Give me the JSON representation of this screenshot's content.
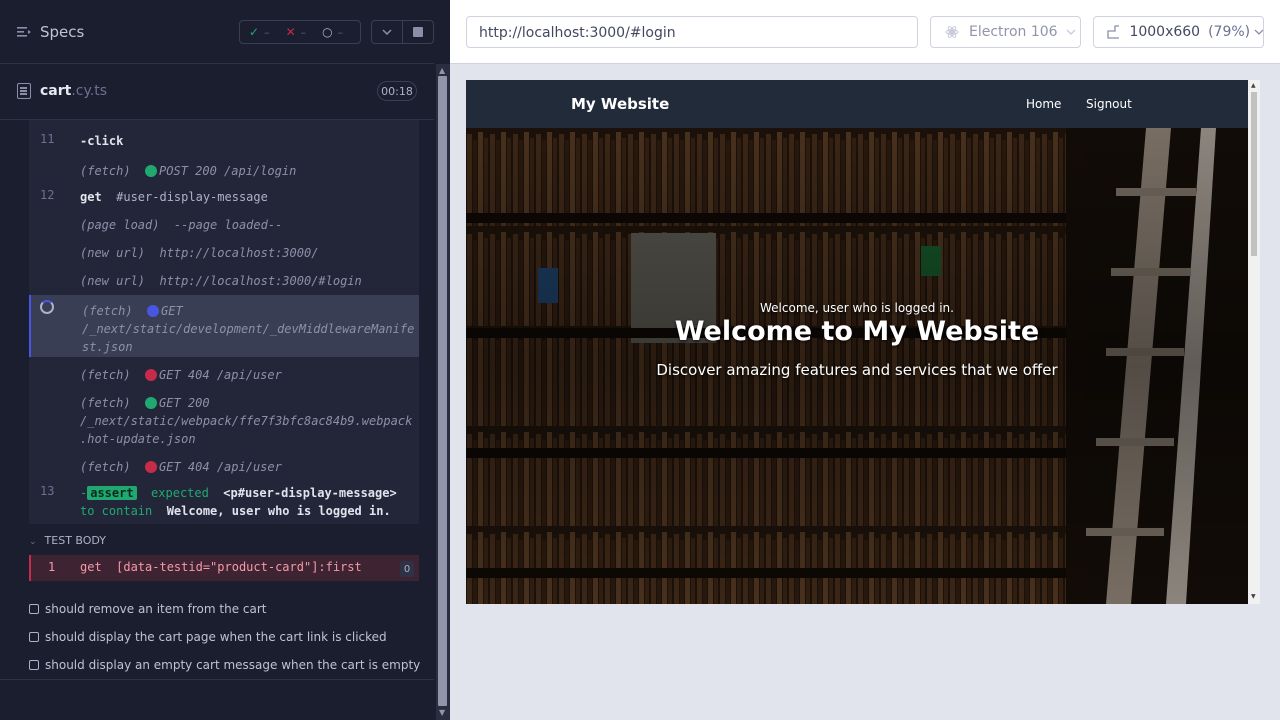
{
  "specs": {
    "title": "Specs",
    "passed": "–",
    "failed": "–",
    "pending": "–"
  },
  "file": {
    "name": "cart",
    "ext": ".cy.ts",
    "time": "00:18"
  },
  "commands": [
    {
      "line": "11",
      "parts": [
        {
          "c": "bold",
          "t": "-click"
        }
      ]
    },
    {
      "line": "",
      "parts": [
        {
          "c": "it",
          "t": "(fetch)  "
        },
        {
          "dot": "#1fa971"
        },
        {
          "c": "it",
          "t": "POST 200 /api/login"
        }
      ]
    },
    {
      "line": "12",
      "parts": [
        {
          "c": "bold",
          "t": "get  "
        },
        {
          "c": "",
          "t": "#user-display-message"
        }
      ]
    },
    {
      "line": "",
      "parts": [
        {
          "c": "it",
          "t": "(page load)  --page loaded--"
        }
      ]
    },
    {
      "line": "",
      "parts": [
        {
          "c": "it",
          "t": "(new url)  http://localhost:3000/"
        }
      ]
    },
    {
      "line": "",
      "parts": [
        {
          "c": "it",
          "t": "(new url)  http://localhost:3000/#login"
        }
      ]
    },
    {
      "line": "",
      "sel": true,
      "parts": [
        {
          "c": "it",
          "t": "(fetch)  "
        },
        {
          "dot": "#4956e3"
        },
        {
          "c": "it",
          "t": "GET\n/_next/static/development/_devMiddlewareManife\nst.json"
        }
      ]
    },
    {
      "line": "",
      "parts": [
        {
          "c": "it",
          "t": "(fetch)  "
        },
        {
          "dot": "#c62b49"
        },
        {
          "c": "it",
          "t": "GET 404 /api/user"
        }
      ]
    },
    {
      "line": "",
      "parts": [
        {
          "c": "it",
          "t": "(fetch)  "
        },
        {
          "dot": "#1fa971"
        },
        {
          "c": "it",
          "t": "GET 200\n/_next/static/webpack/ffe7f3bfc8ac84b9.webpack\n.hot-update.json"
        }
      ]
    },
    {
      "line": "",
      "parts": [
        {
          "c": "it",
          "t": "(fetch)  "
        },
        {
          "dot": "#c62b49"
        },
        {
          "c": "it",
          "t": "GET 404 /api/user"
        }
      ]
    },
    {
      "line": "13",
      "parts": [
        {
          "c": "green",
          "t": "-"
        },
        {
          "c": "assert-badge",
          "t": "assert"
        },
        {
          "c": "green",
          "t": "  expected  "
        },
        {
          "c": "bold",
          "t": "<p#user-display-message>"
        },
        {
          "c": "green",
          "t": "\nto contain  "
        },
        {
          "c": "bold",
          "t": "Welcome, user who is logged in."
        }
      ]
    }
  ],
  "test_body": {
    "header": "TEST BODY",
    "line": "1",
    "cmd": "get  [data-testid=\"product-card\"]:first",
    "count": "0"
  },
  "tests": [
    "should remove an item from the cart",
    "should display the cart page when the cart link is clicked",
    "should display an empty cart message when the cart is empty"
  ],
  "browser_bar": {
    "url": "http://localhost:3000/#login",
    "browser": "Electron 106",
    "viewport": "1000x660",
    "scale": "(79%)"
  },
  "aut": {
    "brand": "My Website",
    "nav": [
      "Home",
      "Signout"
    ],
    "user_msg": "Welcome, user who is logged in.",
    "heading": "Welcome to My Website",
    "subheading": "Discover amazing features and services that we offer"
  },
  "colors": {
    "pass": "#1fa971",
    "fail": "#c62b49",
    "pending": "#4956e3"
  }
}
